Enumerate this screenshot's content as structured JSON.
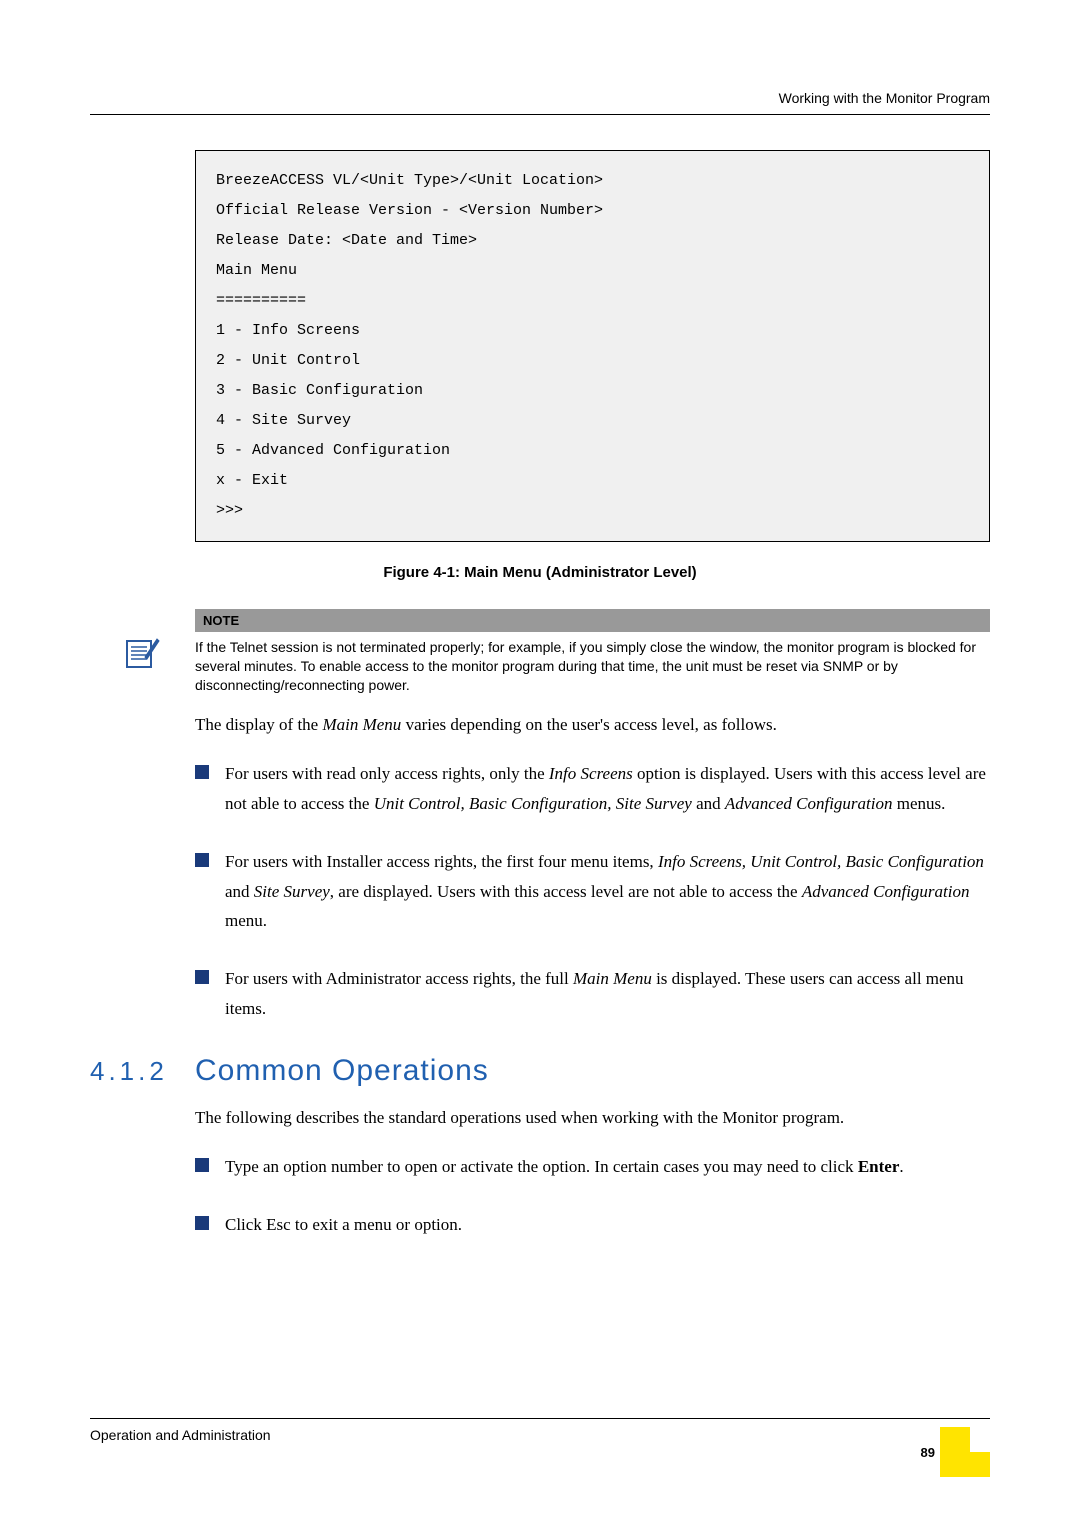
{
  "header": {
    "right_text": "Working with the Monitor Program"
  },
  "code_block": {
    "line1": "BreezeACCESS VL/<Unit Type>/<Unit Location>",
    "line2": "Official Release Version - <Version Number>",
    "line3": "Release Date: <Date and Time>",
    "line4": "Main Menu",
    "line5": "==========",
    "line6": "1 - Info Screens",
    "line7": "2 - Unit Control",
    "line8": "3 - Basic Configuration",
    "line9": "4 - Site Survey",
    "line10": "5 - Advanced Configuration",
    "line11": "x - Exit",
    "line12": ">>>"
  },
  "figure_caption": "Figure 4-1: Main Menu (Administrator Level)",
  "note": {
    "label": "NOTE",
    "body": "If the Telnet session is not terminated properly; for example, if you simply close the window, the monitor program is blocked for several minutes. To enable access to the monitor program during that time, the unit must be reset via SNMP or by disconnecting/reconnecting power."
  },
  "para1": {
    "pre": "The display of the ",
    "italic": "Main Menu",
    "post": " varies depending on the user's access level, as follows."
  },
  "bullet1": {
    "t1": "For users with read only access rights, only the ",
    "i1": "Info Screens",
    "t2": " option is displayed. Users with this access level are not able to access the ",
    "i2": "Unit Control, Basic Configuration, Site Survey",
    "t3": " and ",
    "i3": "Advanced Configuration",
    "t4": " menus."
  },
  "bullet2": {
    "t1": "For users with Installer access rights, the first four menu items, ",
    "i1": "Info Screens, Unit Control, Basic Configuration",
    "t2": " and ",
    "i2": "Site Survey",
    "t3": ", are displayed. Users with this access level are not able to access the ",
    "i3": "Advanced Configuration",
    "t4": " menu."
  },
  "bullet3": {
    "t1": "For users with Administrator access rights, the full ",
    "i1": "Main Menu",
    "t2": " is displayed. These users can access all menu items."
  },
  "section": {
    "number": "4.1.2",
    "title": "Common Operations"
  },
  "para2": "The following describes the standard operations used when working with the Monitor program.",
  "bullet4": {
    "t1": "Type an option number to open or activate the option. In certain cases you may need to click ",
    "b1": "Enter",
    "t2": "."
  },
  "bullet5": "Click Esc to exit a menu or option.",
  "footer": {
    "left": "Operation and Administration",
    "page": "89"
  }
}
